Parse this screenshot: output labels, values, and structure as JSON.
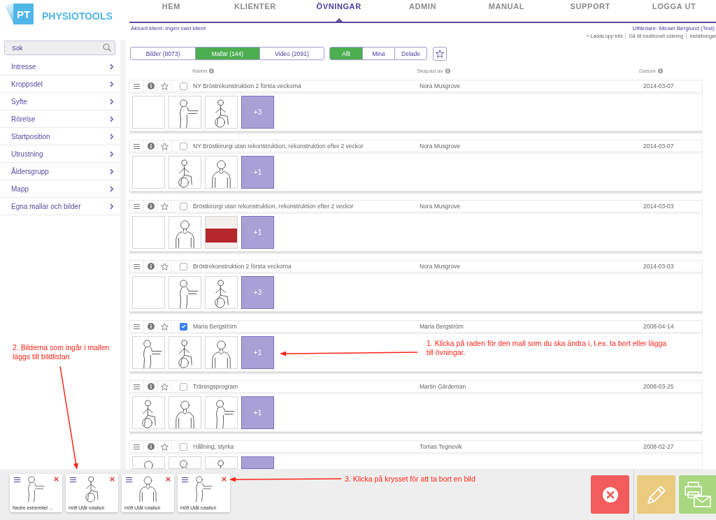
{
  "header": {
    "logo": {
      "mark": "PT",
      "name": "PHYSIOTOOLS"
    },
    "nav": [
      {
        "label": "HEM",
        "selected": false
      },
      {
        "label": "KLIENTER",
        "selected": false
      },
      {
        "label": "ÖVNINGAR",
        "selected": true
      },
      {
        "label": "ADMIN",
        "selected": false
      },
      {
        "label": "MANUAL",
        "selected": false
      },
      {
        "label": "SUPPORT",
        "selected": false
      },
      {
        "label": "LOGGA UT",
        "selected": false
      }
    ],
    "client": "Aktuell klient: Ingen vald klient",
    "issuer": "Utfärdare: Micael Berglund (Test)",
    "links": [
      "+ Ladda upp bild",
      "Gå till traditionell sökning",
      "Inställningar"
    ]
  },
  "sidebar": {
    "search": {
      "placeholder": "Sök"
    },
    "items": [
      "Intresse",
      "Kroppsdel",
      "Syfte",
      "Rörelse",
      "Startposition",
      "Utrustning",
      "Åldersgrupp",
      "Mapp",
      "Egna mallar och bilder"
    ]
  },
  "toolbar": {
    "source_tabs": [
      {
        "label": "Bilder (8073)",
        "selected": false
      },
      {
        "label": "Mallar (144)",
        "selected": true
      },
      {
        "label": "Video (2091)",
        "selected": false
      }
    ],
    "owner_tabs": [
      {
        "label": "Allt",
        "selected": true
      },
      {
        "label": "Mina",
        "selected": false
      },
      {
        "label": "Delade",
        "selected": false
      }
    ]
  },
  "table": {
    "columns": [
      "Namn",
      "Skapad av",
      "Datum"
    ],
    "rows": [
      {
        "name": "NY Bröstrekonstruktion 2 första veckorna",
        "creator": "Nora Musgrove",
        "date": "2014-03-07",
        "checked": false,
        "thumbnails": [
          {
            "kind": "blank"
          },
          {
            "kind": "drawing"
          },
          {
            "kind": "drawing"
          }
        ],
        "more": "+3"
      },
      {
        "name": "NY Bröstkirurgi utan rekonstruktion, rekonstruktion efter 2 veckor",
        "creator": "Nora Musgrove",
        "date": "2014-03-07",
        "checked": false,
        "thumbnails": [
          {
            "kind": "blank"
          },
          {
            "kind": "drawing"
          },
          {
            "kind": "drawing"
          }
        ],
        "more": "+1"
      },
      {
        "name": "Bröstkirurgi utan rekonstruktion, rekonstruktion efter 2 veckor",
        "creator": "Nora Musgrove",
        "date": "2014-03-03",
        "checked": false,
        "thumbnails": [
          {
            "kind": "blank"
          },
          {
            "kind": "drawing"
          },
          {
            "kind": "photo"
          }
        ],
        "more": "+1"
      },
      {
        "name": "Bröstrekonstruktion 2 första veckorna",
        "creator": "Nora Musgrove",
        "date": "2014-03-03",
        "checked": false,
        "thumbnails": [
          {
            "kind": "blank"
          },
          {
            "kind": "drawing"
          },
          {
            "kind": "drawing"
          }
        ],
        "more": "+3"
      },
      {
        "name": "Maria Bergström",
        "creator": "Maria Bergström",
        "date": "2008-04-14",
        "checked": true,
        "thumbnails": [
          {
            "kind": "drawing"
          },
          {
            "kind": "drawing"
          },
          {
            "kind": "drawing"
          }
        ],
        "more": "+1"
      },
      {
        "name": "Träningsprogram",
        "creator": "Martin Gärdeman",
        "date": "2008-03-25",
        "checked": false,
        "thumbnails": [
          {
            "kind": "drawing"
          },
          {
            "kind": "drawing"
          },
          {
            "kind": "drawing"
          }
        ],
        "more": "+1"
      },
      {
        "name": "Hållning, styrka",
        "creator": "Tomas Tegnevik",
        "date": "2008-02-27",
        "checked": false,
        "thumbnails": [
          {
            "kind": "drawing"
          },
          {
            "kind": "drawing"
          },
          {
            "kind": "drawing"
          }
        ]
      }
    ]
  },
  "tray": {
    "images": [
      {
        "caption": "Nedre extremitet ..."
      },
      {
        "caption": "Höft Utåt rotation"
      },
      {
        "caption": "Höft Utåt rotation"
      },
      {
        "caption": "Höft Utåt rotation"
      }
    ],
    "actions": [
      {
        "kind": "delete"
      },
      {
        "kind": "edit"
      },
      {
        "kind": "print_email"
      }
    ]
  },
  "annotations": [
    "1. Klicka på raden för den mall som du ska ändra i, t.ex. ta bort eller lägga till övningar.",
    "2. Bilderna som ingår i mallen läggs till bildlistan",
    "3. Klicka på krysset för att ta bort en bild"
  ]
}
